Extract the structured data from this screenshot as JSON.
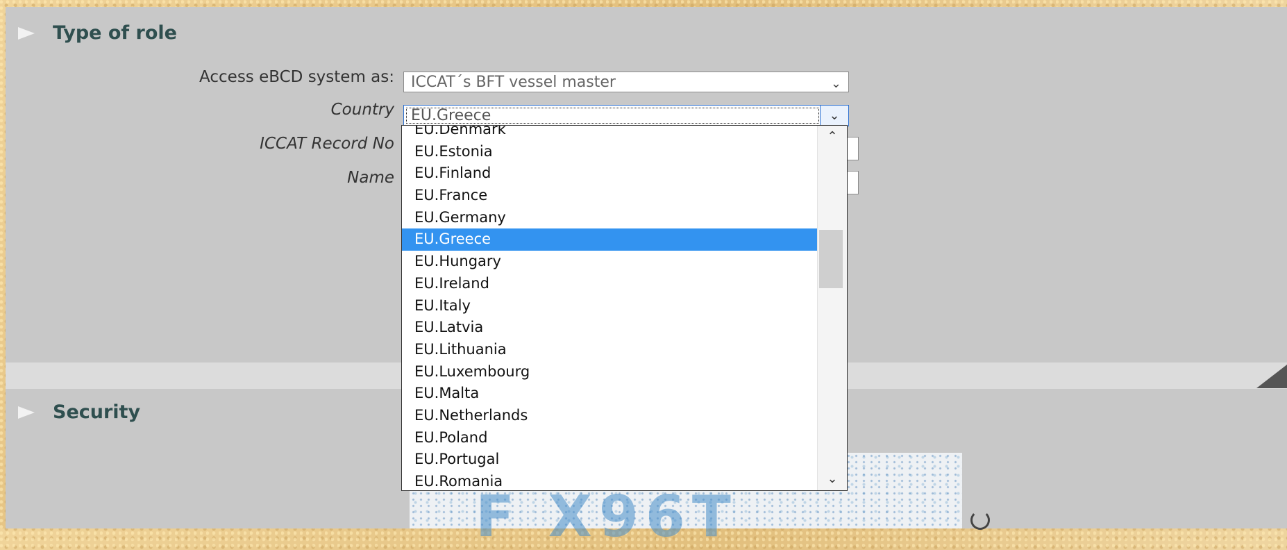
{
  "sections": {
    "role_title": "Type of role",
    "security_title": "Security"
  },
  "form": {
    "access_label": "Access eBCD system as:",
    "access_value": "ICCAT´s BFT vessel master",
    "country_label": "Country",
    "country_value": "EU.Greece",
    "record_label": "ICCAT Record No",
    "name_label": "Name"
  },
  "dropdown": {
    "options": [
      "EU.Denmark",
      "EU.Estonia",
      "EU.Finland",
      "EU.France",
      "EU.Germany",
      "EU.Greece",
      "EU.Hungary",
      "EU.Ireland",
      "EU.Italy",
      "EU.Latvia",
      "EU.Lithuania",
      "EU.Luxembourg",
      "EU.Malta",
      "EU.Netherlands",
      "EU.Poland",
      "EU.Portugal",
      "EU.Romania"
    ],
    "selected": "EU.Greece"
  },
  "captcha": {
    "text": "F X96T"
  },
  "icons": {
    "section_toggle": "triangle-right-icon",
    "select_chevron": "chevron-down-icon",
    "scroll_up": "chevron-up-icon",
    "refresh": "refresh-icon"
  },
  "colors": {
    "selection": "#3393f0",
    "panel": "#c8c8c8",
    "title": "#2f4f4f"
  }
}
